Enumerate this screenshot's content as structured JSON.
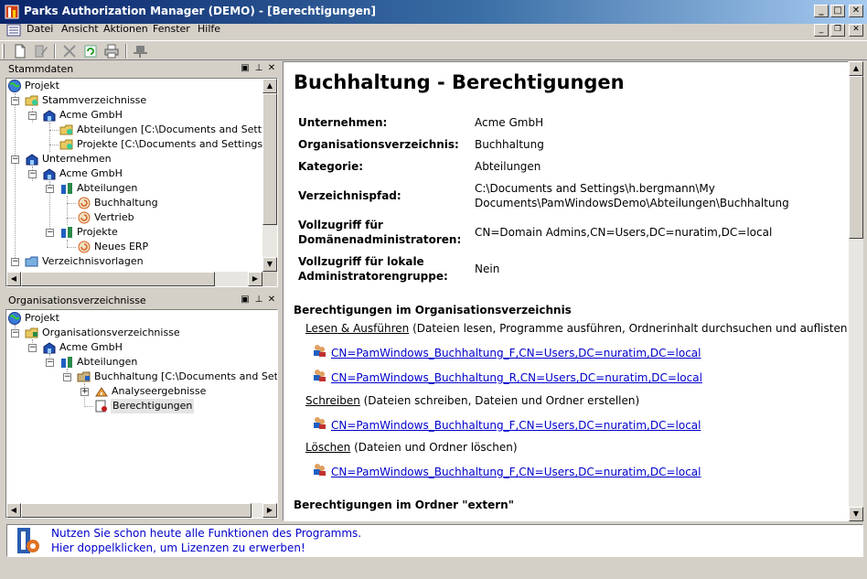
{
  "window": {
    "title": "Parks Authorization Manager (DEMO) - [Berechtigungen]"
  },
  "menu": [
    "Datei",
    "Ansicht",
    "Aktionen",
    "Fenster",
    "Hilfe"
  ],
  "toolbar": {
    "icons": [
      "new-document-icon",
      "edit-icon",
      "delete-icon",
      "refresh-icon",
      "print-icon",
      "pin-icon"
    ]
  },
  "panel_stammdaten": {
    "title": "Stammdaten",
    "tree": [
      "Projekt",
      "Stammverzeichnisse",
      "Acme GmbH",
      "Abteilungen [C:\\Documents and Settings\\h",
      "Projekte [C:\\Documents and Settings\\h.be",
      "Unternehmen",
      "Acme GmbH",
      "Abteilungen",
      "Buchhaltung",
      "Vertrieb",
      "Projekte",
      "Neues ERP",
      "Verzeichnisvorlagen"
    ]
  },
  "panel_org": {
    "title": "Organisationsverzeichnisse",
    "tree": [
      "Projekt",
      "Organisationsverzeichnisse",
      "Acme GmbH",
      "Abteilungen",
      "Buchhaltung [C:\\Documents and Settings\\",
      "Analyseergebnisse",
      "Berechtigungen"
    ]
  },
  "content": {
    "heading": "Buchhaltung - Berechtigungen",
    "props": [
      {
        "label": "Unternehmen:",
        "value": "Acme GmbH"
      },
      {
        "label": "Organisationsverzeichnis:",
        "value": "Buchhaltung"
      },
      {
        "label": "Kategorie:",
        "value": "Abteilungen"
      },
      {
        "label": "Verzeichnispfad:",
        "value1": "C:\\Documents and Settings\\h.bergmann\\My",
        "value2": "Documents\\PamWindowsDemo\\Abteilungen\\Buchhaltung"
      },
      {
        "label1": "Vollzugriff für",
        "label2": "Domänenadministratoren:",
        "value": "CN=Domain Admins,CN=Users,DC=nuratim,DC=local"
      },
      {
        "label1": "Vollzugriff für lokale",
        "label2": "Administratorengruppe:",
        "value": "Nein"
      }
    ],
    "section1": "Berechtigungen im Organisationsverzeichnis",
    "perms": [
      {
        "name": "Lesen & Ausführen",
        "desc": " (Dateien lesen, Programme ausführen, Ordnerinhalt durchsuchen und auflisten)",
        "groups": [
          "CN=PamWindows_Buchhaltung_F,CN=Users,DC=nuratim,DC=local",
          "CN=PamWindows_Buchhaltung_R,CN=Users,DC=nuratim,DC=local"
        ]
      },
      {
        "name": "Schreiben",
        "desc": " (Dateien schreiben, Dateien und Ordner erstellen)",
        "groups": [
          "CN=PamWindows_Buchhaltung_F,CN=Users,DC=nuratim,DC=local"
        ]
      },
      {
        "name": "Löschen",
        "desc": " (Dateien und Ordner löschen)",
        "groups": [
          "CN=PamWindows_Buchhaltung_F,CN=Users,DC=nuratim,DC=local"
        ]
      }
    ],
    "section2": "Berechtigungen im Ordner \"extern\""
  },
  "status": {
    "line1": "Nutzen Sie schon heute alle Funktionen des Programms.",
    "line2": "Hier doppelklicken, um Lizenzen zu erwerben!"
  },
  "colors": {
    "title_start": "#0a246a",
    "title_end": "#a6caf0",
    "link": "#0000cc",
    "selection": "#e4e4e4"
  }
}
